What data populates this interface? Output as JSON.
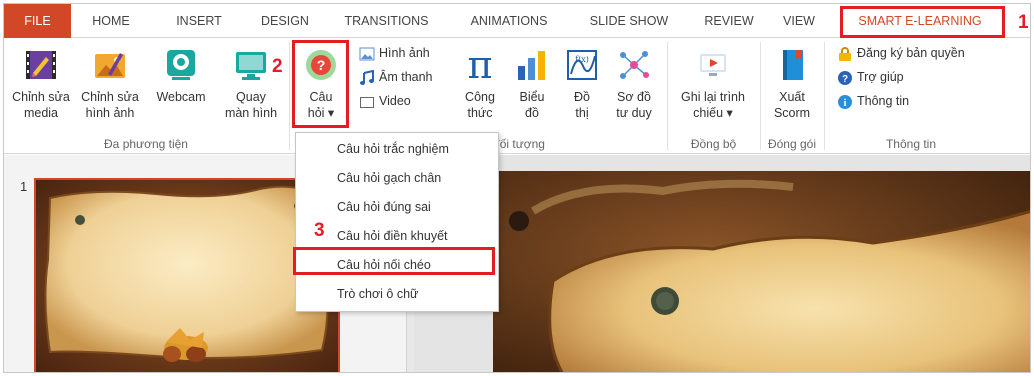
{
  "tabs": {
    "file": "FILE",
    "home": "HOME",
    "insert": "INSERT",
    "design": "DESIGN",
    "transitions": "TRANSITIONS",
    "animations": "ANIMATIONS",
    "slideshow": "SLIDE SHOW",
    "review": "REVIEW",
    "view": "VIEW",
    "smart": "SMART E-LEARNING"
  },
  "ribbon": {
    "edit_media": [
      "Chỉnh sửa",
      "media"
    ],
    "edit_image": [
      "Chỉnh sửa",
      "hình ảnh"
    ],
    "webcam": "Webcam",
    "screen_record": [
      "Quay",
      "màn hình"
    ],
    "group_media": "Đa phương tiện",
    "question": [
      "Câu",
      "hỏi ▾"
    ],
    "image": "Hình ảnh",
    "audio": "Âm thanh",
    "video": "Video",
    "formula": [
      "Công",
      "thức"
    ],
    "chart": [
      "Biểu",
      "đồ"
    ],
    "graph": [
      "Đồ",
      "thị"
    ],
    "mindmap": [
      "Sơ đồ",
      "tư duy"
    ],
    "group_objects": "đối tượng",
    "record_show": [
      "Ghi lại trình",
      "chiếu ▾"
    ],
    "group_sync": "Đồng bộ",
    "export_scorm": [
      "Xuất",
      "Scorm"
    ],
    "group_package": "Đóng gói",
    "register": "Đăng ký bản quyền",
    "help": "Trợ giúp",
    "info": "Thông tin",
    "group_info": "Thông tin"
  },
  "dropdown": {
    "items": [
      "Câu hỏi trắc nghiệm",
      "Câu hỏi gạch chân",
      "Câu hỏi đúng sai",
      "Câu hỏi điền khuyết",
      "Câu hỏi nối chéo",
      "Trò chơi ô chữ"
    ]
  },
  "annotations": {
    "n1": "1",
    "n2": "2",
    "n3": "3"
  },
  "slide_panel": {
    "slide_number": "1"
  },
  "colors": {
    "accent": "#d24726",
    "highlight": "#e41d25"
  }
}
